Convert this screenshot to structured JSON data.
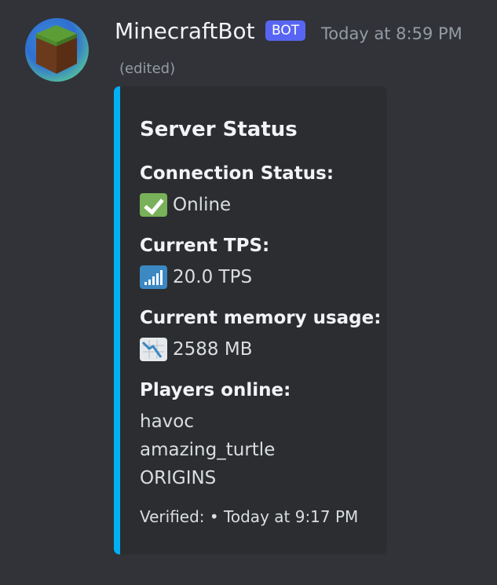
{
  "message": {
    "author": "MinecraftBot",
    "bot_tag": "BOT",
    "timestamp": "Today at 8:59 PM",
    "edited": "(edited)",
    "avatar_icon": "grass-block-icon"
  },
  "embed": {
    "accent_color": "#00b0f4",
    "title": "Server Status",
    "fields": [
      {
        "name": "Connection Status:",
        "value": "Online",
        "icon": "white-check-mark-icon"
      },
      {
        "name": "Current TPS:",
        "value": "20.0 TPS",
        "icon": "signal-strength-icon"
      },
      {
        "name": "Current memory usage:",
        "value": "2588 MB",
        "icon": "chart-decreasing-icon"
      },
      {
        "name": "Players online:",
        "players": [
          "havoc",
          "amazing_turtle",
          "ORIGINS"
        ]
      }
    ],
    "footer": "Verified: • Today at 9:17 PM"
  }
}
